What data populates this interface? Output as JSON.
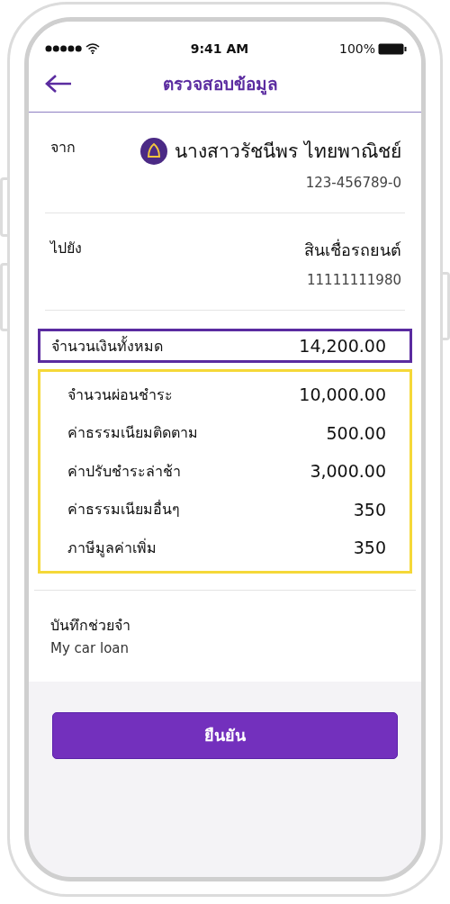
{
  "status_bar": {
    "time": "9:41 AM",
    "battery": "100%"
  },
  "header": {
    "title": "ตรวจสอบข้อมูล"
  },
  "from": {
    "label": "จาก",
    "name": "นางสาวรัชนีพร ไทยพาณิชย์",
    "account": "123-456789-0"
  },
  "to": {
    "label": "ไปยัง",
    "name": "สินเชื่อรถยนต์",
    "account": "11111111980"
  },
  "total": {
    "label": "จำนวนเงินทั้งหมด",
    "value": "14,200.00"
  },
  "breakdown": [
    {
      "label": "จำนวนผ่อนชำระ",
      "value": "10,000.00"
    },
    {
      "label": "ค่าธรรมเนียมติดตาม",
      "value": "500.00"
    },
    {
      "label": "ค่าปรับชำระล่าช้า",
      "value": "3,000.00"
    },
    {
      "label": "ค่าธรรมเนียมอื่นๆ",
      "value": "350"
    },
    {
      "label": "ภาษีมูลค่าเพิ่ม",
      "value": "350"
    }
  ],
  "note": {
    "label": "บันทึกช่วยจำ",
    "value": "My car loan"
  },
  "confirm_button": "ยืนยัน"
}
